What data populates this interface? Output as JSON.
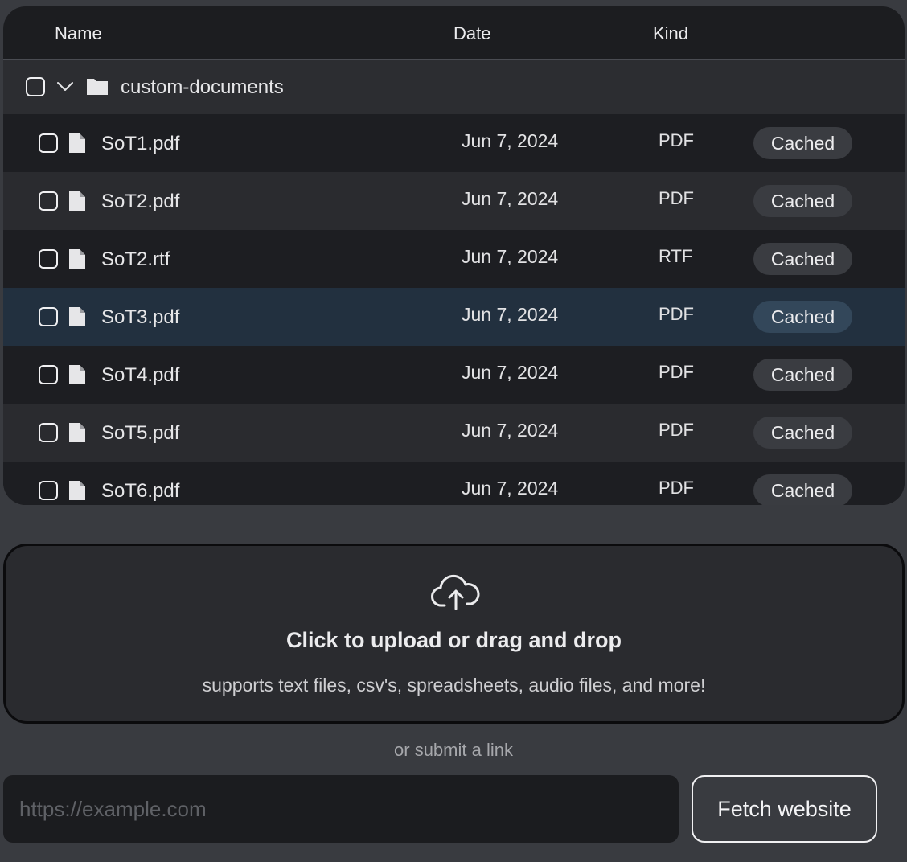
{
  "table": {
    "headers": {
      "name": "Name",
      "date": "Date",
      "kind": "Kind"
    },
    "folder": {
      "name": "custom-documents",
      "icons": [
        "chevron-down-icon",
        "folder-icon"
      ]
    },
    "rows": [
      {
        "name": "SoT1.pdf",
        "date": "Jun 7, 2024",
        "kind": "PDF",
        "status": "Cached"
      },
      {
        "name": "SoT2.pdf",
        "date": "Jun 7, 2024",
        "kind": "PDF",
        "status": "Cached"
      },
      {
        "name": "SoT2.rtf",
        "date": "Jun 7, 2024",
        "kind": "RTF",
        "status": "Cached"
      },
      {
        "name": "SoT3.pdf",
        "date": "Jun 7, 2024",
        "kind": "PDF",
        "status": "Cached"
      },
      {
        "name": "SoT4.pdf",
        "date": "Jun 7, 2024",
        "kind": "PDF",
        "status": "Cached"
      },
      {
        "name": "SoT5.pdf",
        "date": "Jun 7, 2024",
        "kind": "PDF",
        "status": "Cached"
      },
      {
        "name": "SoT6.pdf",
        "date": "Jun 7, 2024",
        "kind": "PDF",
        "status": "Cached"
      }
    ]
  },
  "upload": {
    "icon": "cloud-upload-icon",
    "title": "Click to upload or drag and drop",
    "subtitle": "supports text files, csv's, spreadsheets, audio files, and more!"
  },
  "link": {
    "divider": "or submit a link",
    "placeholder": "https://example.com",
    "button": "Fetch website"
  },
  "colors": {
    "background": "#393b40",
    "panel": "#1c1d20",
    "row_alt": "#2a2b2f",
    "row_selected": "#22303f",
    "badge": "#3a3c41"
  }
}
